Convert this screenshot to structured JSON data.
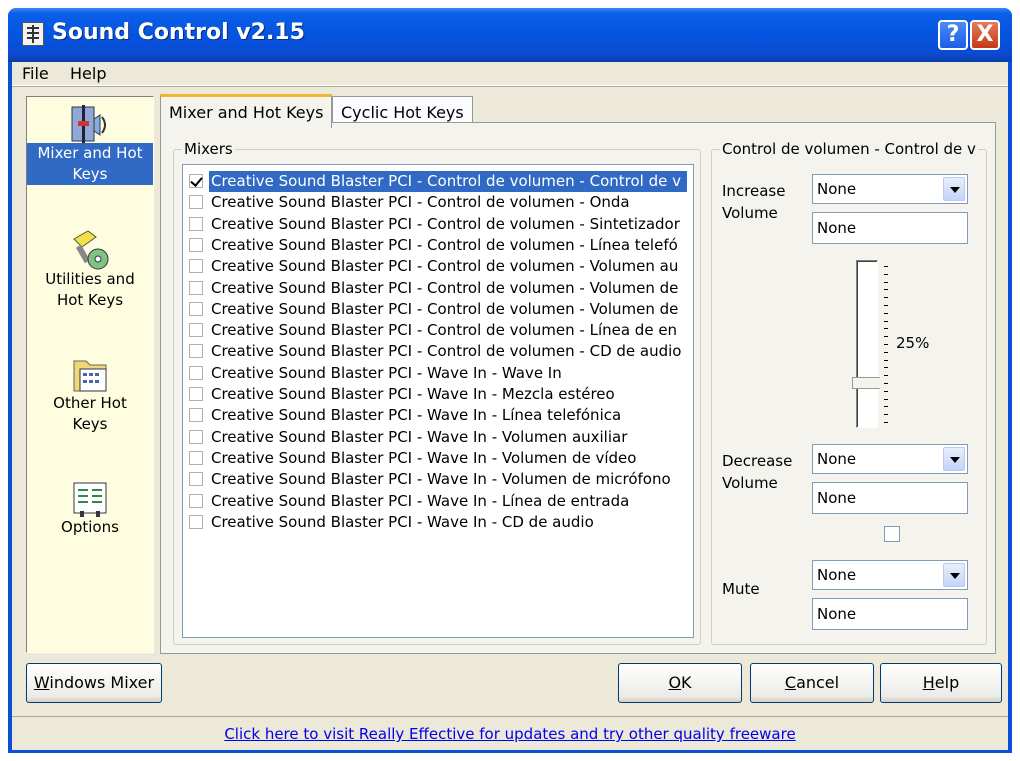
{
  "window": {
    "title": "Sound Control v2.15",
    "help_button": "?",
    "close_button": "X"
  },
  "menu": {
    "items": [
      "File",
      "Help"
    ]
  },
  "sidebar": {
    "items": [
      {
        "label_lines": [
          "Mixer and Hot",
          "Keys"
        ],
        "icon": "speaker-slider-icon",
        "selected": true
      },
      {
        "label_lines": [
          "Utilities and",
          "Hot Keys"
        ],
        "icon": "tools-cd-icon",
        "selected": false
      },
      {
        "label_lines": [
          "Other Hot",
          "Keys"
        ],
        "icon": "folder-keyboard-icon",
        "selected": false
      },
      {
        "label_lines": [
          "Options"
        ],
        "icon": "options-panel-icon",
        "selected": false
      }
    ]
  },
  "tabs": [
    {
      "label": "Mixer and Hot Keys",
      "active": true
    },
    {
      "label": "Cyclic Hot Keys",
      "active": false
    }
  ],
  "mixers": {
    "group_label": "Mixers",
    "items": [
      {
        "text": "Creative Sound Blaster PCI - Control de volumen - Control de v",
        "checked": true,
        "selected": true
      },
      {
        "text": "Creative Sound Blaster PCI - Control de volumen - Onda",
        "checked": false,
        "selected": false
      },
      {
        "text": "Creative Sound Blaster PCI - Control de volumen - Sintetizador",
        "checked": false,
        "selected": false
      },
      {
        "text": "Creative Sound Blaster PCI - Control de volumen - Línea telefó",
        "checked": false,
        "selected": false
      },
      {
        "text": "Creative Sound Blaster PCI - Control de volumen - Volumen au",
        "checked": false,
        "selected": false
      },
      {
        "text": "Creative Sound Blaster PCI - Control de volumen - Volumen de",
        "checked": false,
        "selected": false
      },
      {
        "text": "Creative Sound Blaster PCI - Control de volumen - Volumen de",
        "checked": false,
        "selected": false
      },
      {
        "text": "Creative Sound Blaster PCI - Control de volumen - Línea de en",
        "checked": false,
        "selected": false
      },
      {
        "text": "Creative Sound Blaster PCI - Control de volumen - CD de audio",
        "checked": false,
        "selected": false
      },
      {
        "text": "Creative Sound Blaster PCI - Wave In - Wave In",
        "checked": false,
        "selected": false
      },
      {
        "text": "Creative Sound Blaster PCI - Wave In - Mezcla estéreo",
        "checked": false,
        "selected": false
      },
      {
        "text": "Creative Sound Blaster PCI - Wave In - Línea telefónica",
        "checked": false,
        "selected": false
      },
      {
        "text": "Creative Sound Blaster PCI - Wave In - Volumen auxiliar",
        "checked": false,
        "selected": false
      },
      {
        "text": "Creative Sound Blaster PCI - Wave In - Volumen de vídeo",
        "checked": false,
        "selected": false
      },
      {
        "text": "Creative Sound Blaster PCI - Wave In - Volumen de micrófono",
        "checked": false,
        "selected": false
      },
      {
        "text": "Creative Sound Blaster PCI - Wave In - Línea de entrada",
        "checked": false,
        "selected": false
      },
      {
        "text": "Creative Sound Blaster PCI - Wave In - CD de audio",
        "checked": false,
        "selected": false
      }
    ]
  },
  "control": {
    "group_label": "Control de volumen - Control de v",
    "increase_label_lines": [
      "Increase",
      "Volume"
    ],
    "increase_combo": "None",
    "increase_text": "None",
    "volume_percent_label": "25%",
    "volume_level": 0.25,
    "decrease_label_lines": [
      "Decrease",
      "Volume"
    ],
    "decrease_combo": "None",
    "decrease_text": "None",
    "mute_checked": false,
    "mute_label": "Mute",
    "mute_combo": "None",
    "mute_text": "None"
  },
  "buttons": {
    "windows_mixer": {
      "first": "W",
      "rest": "indows Mixer"
    },
    "ok": {
      "first": "O",
      "rest": "K"
    },
    "cancel": {
      "first": "C",
      "rest": "ancel"
    },
    "help": {
      "first": "H",
      "rest": "elp"
    }
  },
  "footer": {
    "link_text": "Click here to visit Really Effective for updates and try other quality freeware"
  }
}
